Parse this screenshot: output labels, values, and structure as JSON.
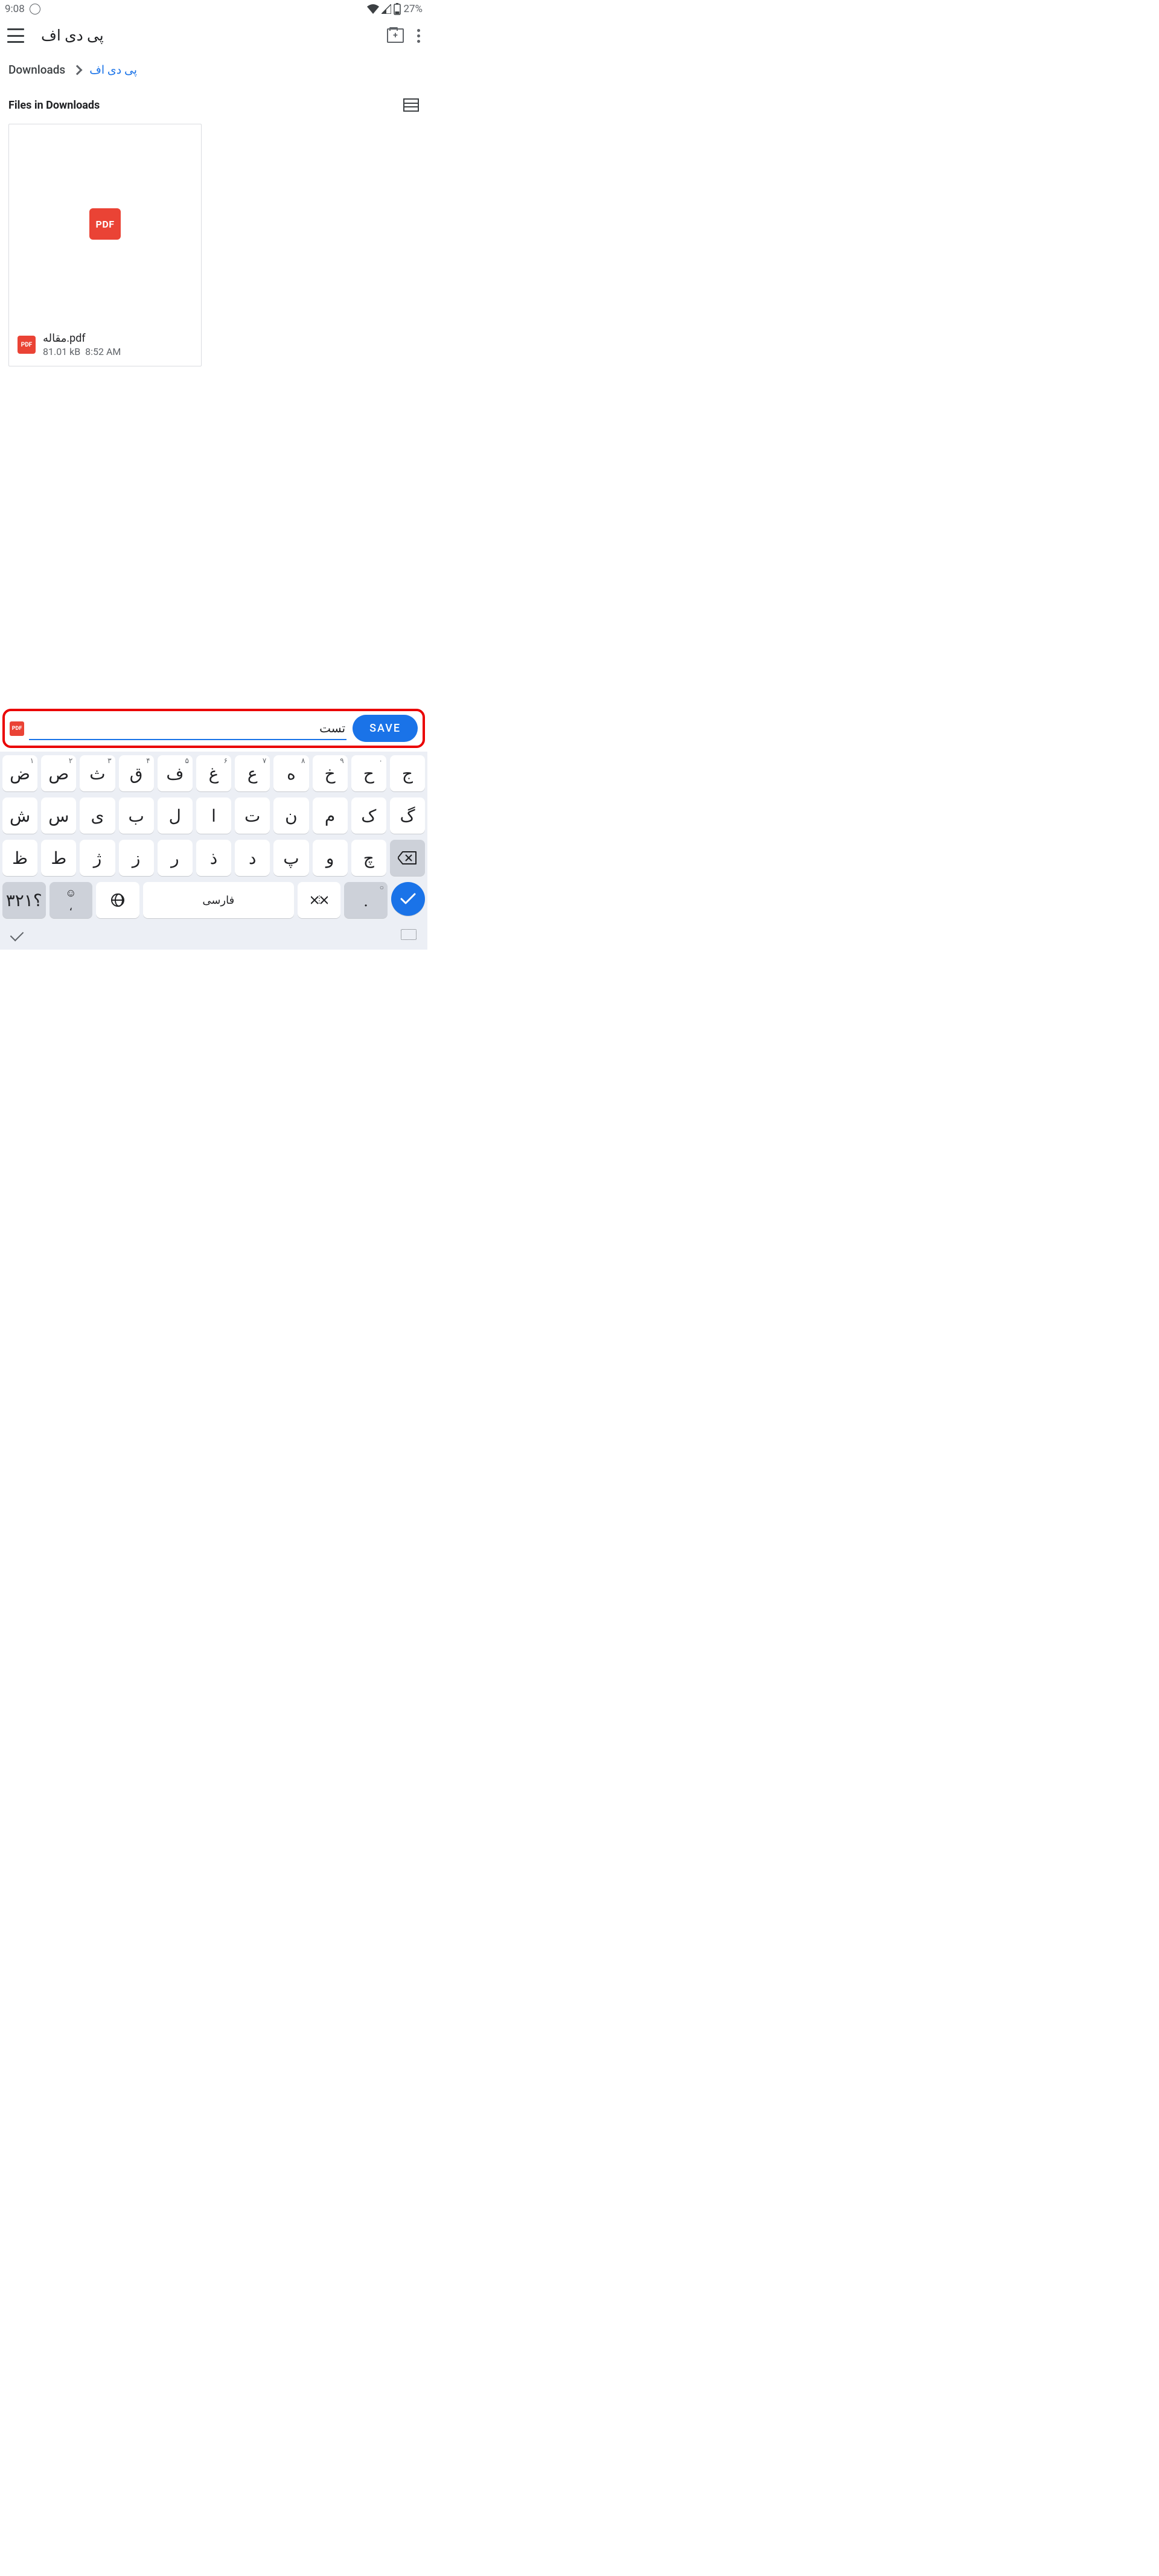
{
  "status": {
    "time": "9:08",
    "battery": "27%"
  },
  "app": {
    "title": "پی دی اف",
    "breadcrumb": {
      "root": "Downloads",
      "current": "پی دی اف"
    },
    "section_label": "Files in Downloads"
  },
  "files": [
    {
      "name": "مقاله.pdf",
      "size": "81.01 kB",
      "time": "8:52 AM",
      "pdf_label": "PDF"
    }
  ],
  "save_bar": {
    "filename": "تست",
    "pdf_label": "PDF",
    "save_label": "SAVE"
  },
  "keyboard": {
    "row1": [
      {
        "char": "ض",
        "sup": "۱"
      },
      {
        "char": "ص",
        "sup": "۲"
      },
      {
        "char": "ث",
        "sup": "۳"
      },
      {
        "char": "ق",
        "sup": "۴"
      },
      {
        "char": "ف",
        "sup": "۵"
      },
      {
        "char": "غ",
        "sup": "۶"
      },
      {
        "char": "ع",
        "sup": "۷"
      },
      {
        "char": "ه",
        "sup": "۸"
      },
      {
        "char": "خ",
        "sup": "۹"
      },
      {
        "char": "ح",
        "sup": "۰"
      },
      {
        "char": "ج",
        "sup": ""
      }
    ],
    "row2": [
      {
        "char": "ش"
      },
      {
        "char": "س"
      },
      {
        "char": "ی"
      },
      {
        "char": "ب"
      },
      {
        "char": "ل"
      },
      {
        "char": "ا"
      },
      {
        "char": "ت"
      },
      {
        "char": "ن"
      },
      {
        "char": "م"
      },
      {
        "char": "ک"
      },
      {
        "char": "گ"
      }
    ],
    "row3": [
      {
        "char": "ظ"
      },
      {
        "char": "ط"
      },
      {
        "char": "ژ"
      },
      {
        "char": "ز"
      },
      {
        "char": "ر"
      },
      {
        "char": "ذ"
      },
      {
        "char": "د"
      },
      {
        "char": "پ"
      },
      {
        "char": "و"
      },
      {
        "char": "چ"
      }
    ],
    "bottom": {
      "symbols": "؟۳۲۱",
      "emoji": "☺",
      "comma": "،",
      "space": "فارسی",
      "period": ".",
      "period_sup": "○"
    }
  }
}
